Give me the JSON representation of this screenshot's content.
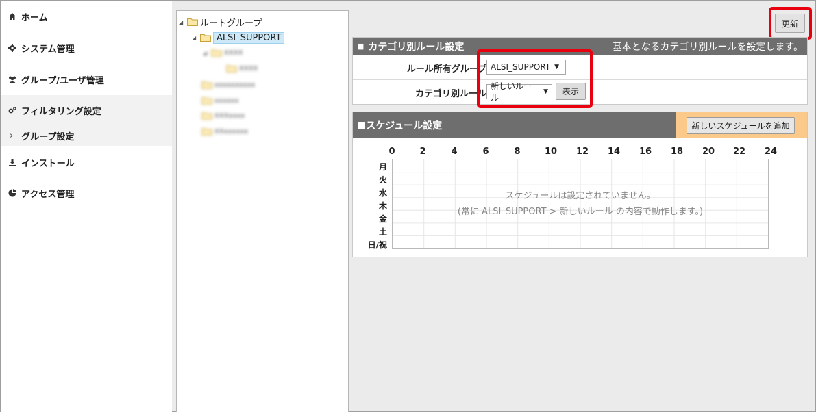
{
  "sidebar": {
    "items": [
      {
        "label": "ホーム",
        "icon": "home-icon"
      },
      {
        "label": "システム管理",
        "icon": "gear-icon"
      },
      {
        "label": "グループ/ユーザ管理",
        "icon": "users-icon"
      },
      {
        "label": "フィルタリング設定",
        "icon": "gears-icon"
      },
      {
        "label": "インストール",
        "icon": "download-icon"
      },
      {
        "label": "アクセス管理",
        "icon": "pie-chart-icon"
      }
    ],
    "sub_item": {
      "label": "グループ設定",
      "chevron": "›"
    }
  },
  "tree": {
    "root": "ルートグループ",
    "selected": "ALSI_SUPPORT",
    "blurred_children": [
      "XXXX",
      "XXXX",
      "xxxxxxxxxx",
      "xxxxxx",
      "XXXxxxx",
      "XXxxxxxx"
    ]
  },
  "toolbar": {
    "refresh_label": "更新"
  },
  "category_panel": {
    "title": "カテゴリ別ルール設定",
    "description": "基本となるカテゴリ別ルールを設定します。",
    "owner_group_label": "ルール所有グループ",
    "owner_group_value": "ALSI_SUPPORT",
    "category_rule_label": "カテゴリ別ルール",
    "category_rule_value": "新しいルール",
    "show_button": "表示"
  },
  "schedule_panel": {
    "title": "スケジュール設定",
    "add_button": "新しいスケジュールを追加",
    "hours": [
      "0",
      "2",
      "4",
      "6",
      "8",
      "10",
      "12",
      "14",
      "16",
      "18",
      "20",
      "22",
      "24"
    ],
    "days": [
      "月",
      "火",
      "水",
      "木",
      "金",
      "土",
      "日/祝"
    ],
    "empty_message": "スケジュールは設定されていません。",
    "empty_note": "(常に ALSI_SUPPORT > 新しいルール の内容で動作します。)"
  },
  "colors": {
    "panel_header": "#6e6e6e",
    "highlight": "#e8000f",
    "add_area": "#fbc98a",
    "tree_selected": "#cde8f7"
  }
}
